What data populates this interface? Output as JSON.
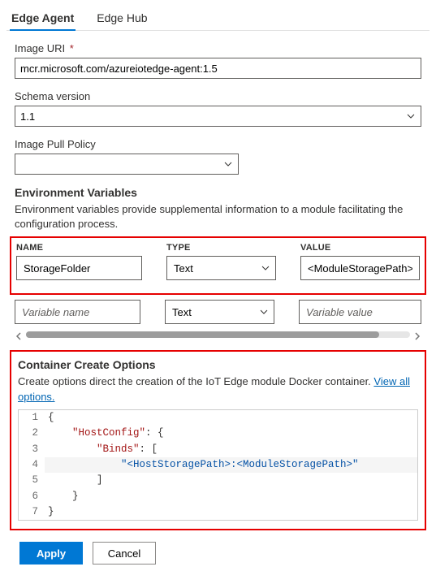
{
  "tabs": {
    "edge_agent": "Edge Agent",
    "edge_hub": "Edge Hub"
  },
  "fields": {
    "image_uri_label": "Image URI",
    "image_uri_required": "*",
    "image_uri_value": "mcr.microsoft.com/azureiotedge-agent:1.5",
    "schema_version_label": "Schema version",
    "schema_version_value": "1.1",
    "image_pull_policy_label": "Image Pull Policy",
    "image_pull_policy_value": ""
  },
  "env": {
    "title": "Environment Variables",
    "desc": "Environment variables provide supplemental information to a module facilitating the configuration process.",
    "headers": {
      "name": "NAME",
      "type": "TYPE",
      "value": "VALUE"
    },
    "rows": [
      {
        "name": "StorageFolder",
        "type": "Text",
        "value": "<ModuleStoragePath>"
      }
    ],
    "placeholder_row": {
      "name_ph": "Variable name",
      "type_value": "Text",
      "value_ph": "Variable value"
    }
  },
  "cco": {
    "title": "Container Create Options",
    "desc_prefix": "Create options direct the creation of the IoT Edge module Docker container. ",
    "link_text": "View all options.",
    "code_lines": [
      {
        "n": 1,
        "plain": "{"
      },
      {
        "n": 2,
        "indent": "    ",
        "key": "HostConfig",
        "after": ": {"
      },
      {
        "n": 3,
        "indent": "        ",
        "key": "Binds",
        "after": ": ["
      },
      {
        "n": 4,
        "indent": "            ",
        "str": "<HostStoragePath>:<ModuleStoragePath>"
      },
      {
        "n": 5,
        "plain": "        ]"
      },
      {
        "n": 6,
        "plain": "    }"
      },
      {
        "n": 7,
        "plain": "}"
      }
    ]
  },
  "buttons": {
    "apply": "Apply",
    "cancel": "Cancel"
  }
}
